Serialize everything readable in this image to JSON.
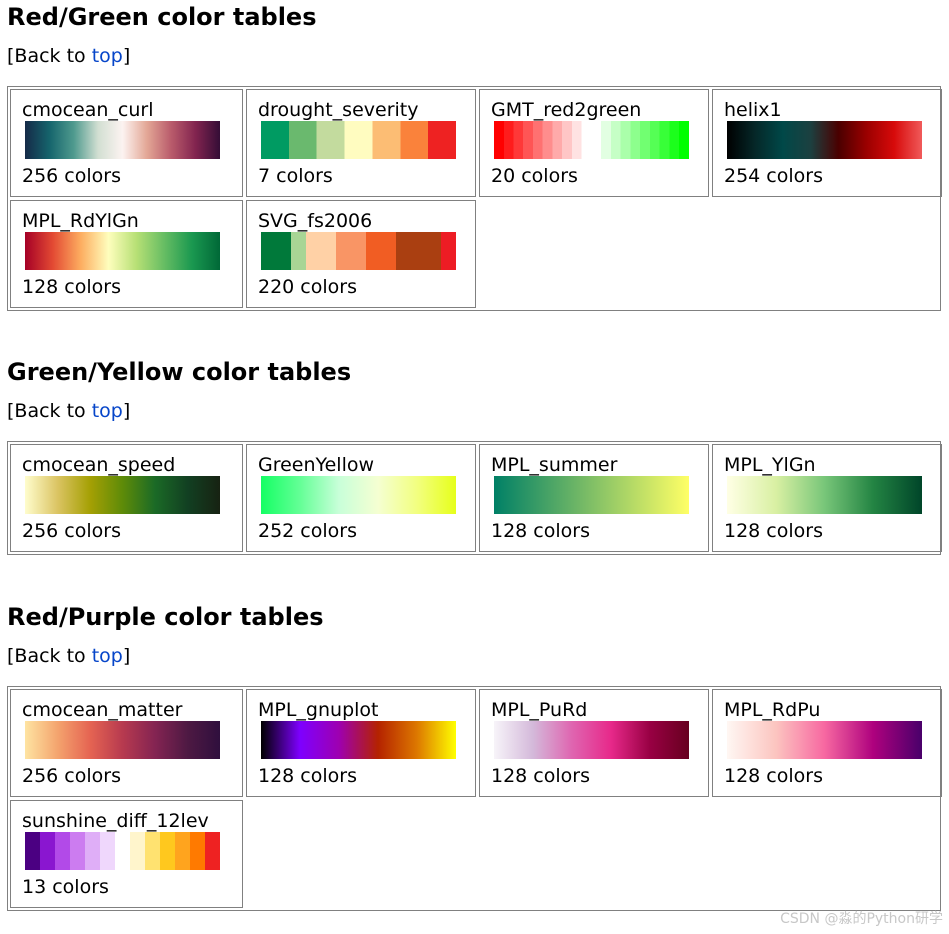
{
  "back_text_before": "[Back to ",
  "back_link": "top",
  "back_text_after": "]",
  "watermark": "CSDN @淼的Python研学",
  "sections": [
    {
      "title": "Red/Green color tables",
      "tables": [
        {
          "name": "cmocean_curl",
          "count": "256 colors",
          "mode": "smooth",
          "colors": [
            "#152a48",
            "#15646c",
            "#4f9a8e",
            "#d2dfd2",
            "#fcf3f1",
            "#e3a796",
            "#b95b6b",
            "#82244f",
            "#340d36"
          ]
        },
        {
          "name": "drought_severity",
          "count": "7 colors",
          "mode": "steps",
          "colors": [
            "#009b62",
            "#6ab96e",
            "#c3db9e",
            "#fffcc0",
            "#fcbd74",
            "#fa823b",
            "#ee2222"
          ]
        },
        {
          "name": "GMT_red2green",
          "count": "20 colors",
          "mode": "steps",
          "colors": [
            "#ff0000",
            "#ff1c1c",
            "#ff3838",
            "#ff5555",
            "#ff7171",
            "#ff8d8d",
            "#ffaaaa",
            "#ffc6c6",
            "#ffe2e2",
            "#ffffff",
            "#ffffff",
            "#e2ffe2",
            "#c6ffc6",
            "#aaffaa",
            "#8dff8d",
            "#71ff71",
            "#55ff55",
            "#38ff38",
            "#1cff1c",
            "#00ff00"
          ]
        },
        {
          "name": "helix1",
          "count": "254 colors",
          "mode": "smooth",
          "colors": [
            "#000000",
            "#052728",
            "#004848",
            "#1c4040",
            "#4a0000",
            "#9a0000",
            "#d70a0a",
            "#f05a5a"
          ]
        },
        {
          "name": "MPL_RdYlGn",
          "count": "128 colors",
          "mode": "smooth",
          "colors": [
            "#a50026",
            "#e34a33",
            "#fdad60",
            "#fefebd",
            "#b7e075",
            "#66bd63",
            "#1a9850",
            "#006837"
          ]
        },
        {
          "name": "SVG_fs2006",
          "count": "220 colors",
          "mode": "steps",
          "colors": [
            "#00793a",
            "#00793a",
            "#a8d595",
            "#ffd1a6",
            "#ffd1a6",
            "#f99565",
            "#f99565",
            "#f15d23",
            "#f15d23",
            "#aa3f11",
            "#aa3f11",
            "#aa3f11",
            "#ed1c24"
          ]
        }
      ]
    },
    {
      "title": "Green/Yellow color tables",
      "tables": [
        {
          "name": "cmocean_speed",
          "count": "256 colors",
          "mode": "smooth",
          "colors": [
            "#fffdcd",
            "#dbc463",
            "#a5a004",
            "#5e8b08",
            "#1b6a26",
            "#124022",
            "#172212"
          ]
        },
        {
          "name": "GreenYellow",
          "count": "252 colors",
          "mode": "smooth",
          "colors": [
            "#14ff64",
            "#64ff96",
            "#c8ffd9",
            "#f5ffd2",
            "#f2ff80",
            "#e6ff1a"
          ]
        },
        {
          "name": "MPL_summer",
          "count": "128 colors",
          "mode": "smooth",
          "colors": [
            "#008066",
            "#409f66",
            "#80bf66",
            "#bfdf66",
            "#ffff66"
          ]
        },
        {
          "name": "MPL_YlGn",
          "count": "128 colors",
          "mode": "smooth",
          "colors": [
            "#ffffe5",
            "#d9f0a3",
            "#78c679",
            "#238443",
            "#004529"
          ]
        }
      ]
    },
    {
      "title": "Red/Purple color tables",
      "tables": [
        {
          "name": "cmocean_matter",
          "count": "256 colors",
          "mode": "smooth",
          "colors": [
            "#fee4a2",
            "#f4a46e",
            "#e56452",
            "#b73a4f",
            "#842452",
            "#4e1943",
            "#2f0f3d"
          ]
        },
        {
          "name": "MPL_gnuplot",
          "count": "128 colors",
          "mode": "smooth",
          "colors": [
            "#000000",
            "#7e00ff",
            "#9e00b0",
            "#b42200",
            "#dd7800",
            "#ffff00"
          ]
        },
        {
          "name": "MPL_PuRd",
          "count": "128 colors",
          "mode": "smooth",
          "colors": [
            "#f7f4f9",
            "#d4b9da",
            "#df65b0",
            "#e7298a",
            "#980043",
            "#67001f"
          ]
        },
        {
          "name": "MPL_RdPu",
          "count": "128 colors",
          "mode": "smooth",
          "colors": [
            "#fff7f3",
            "#fcc5c0",
            "#f768a1",
            "#ae017e",
            "#49006a"
          ]
        },
        {
          "name": "sunshine_diff_12lev",
          "count": "13 colors",
          "mode": "steps",
          "colors": [
            "#4b0082",
            "#8a16d0",
            "#b24ae8",
            "#cc7cf0",
            "#dfaef7",
            "#efd7fc",
            "#ffffff",
            "#fff5cc",
            "#ffe270",
            "#ffc81e",
            "#ffa41e",
            "#ff7a00",
            "#ee2222"
          ]
        }
      ]
    }
  ]
}
